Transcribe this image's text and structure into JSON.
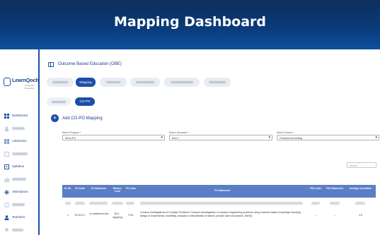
{
  "banner": {
    "title": "Mapping Dashboard"
  },
  "logo": {
    "name": "LearnQoch",
    "tagline": "Outcomes Perfected"
  },
  "sidebar": {
    "items": [
      {
        "label": "Dashboard",
        "icon": "grid-icon",
        "visible": true
      },
      {
        "label": "",
        "icon": "users-icon",
        "visible": false
      },
      {
        "label": "Admission",
        "icon": "doc-icon",
        "visible": true
      },
      {
        "label": "",
        "icon": "book-icon",
        "visible": false
      },
      {
        "label": "Syllabus",
        "icon": "list-icon",
        "visible": true
      },
      {
        "label": "",
        "icon": "chart-icon",
        "visible": false
      },
      {
        "label": "Attendance",
        "icon": "calendar-icon",
        "visible": true
      },
      {
        "label": "",
        "icon": "clock-icon",
        "visible": false
      },
      {
        "label": "Teachers",
        "icon": "teacher-icon",
        "visible": true
      },
      {
        "label": "",
        "icon": "user-icon",
        "visible": false
      }
    ]
  },
  "page": {
    "title": "Outcome Based Education (OBE)"
  },
  "tabs": [
    {
      "label": "",
      "active": false
    },
    {
      "label": "Mapping",
      "active": true
    },
    {
      "label": "",
      "active": false
    },
    {
      "label": "",
      "active": false
    },
    {
      "label": "",
      "active": false
    },
    {
      "label": "",
      "active": false
    }
  ],
  "subtabs": [
    {
      "label": "",
      "active": false
    },
    {
      "label": "CO-PO",
      "active": true
    }
  ],
  "add_mapping": {
    "label": "Add CO-PO Mapping"
  },
  "filters": {
    "program": {
      "label": "Select Program *",
      "value": "MCA (P.I)"
    },
    "semester": {
      "label": "Select Semester *",
      "value": "sem 2"
    },
    "course": {
      "label": "Select Course *",
      "value": "Financial Accounting"
    }
  },
  "search": {
    "placeholder": "Search"
  },
  "table": {
    "headers": [
      "Sr. No.",
      "CO Code",
      "CO Statement",
      "Blooms Level",
      "PO Code",
      "PO Statement",
      "PSO Code",
      "PSO Statement",
      "Average Correlation"
    ],
    "row": {
      "sr": "1",
      "co_code": "EIT212.2",
      "co_statement": "co statement test",
      "blooms": "BL3 - Applying",
      "po_code": "PO1",
      "po_statement": "Conduct Investigations of Complex Problems: Conduct investigations of complex engineering problems using research-based knowledge including design of experiments, modelling, analysis & interpretation of data to provide valid conclusions. (WK8).",
      "pso_code": "–",
      "pso_statement": "–",
      "avg": "2.5"
    }
  },
  "colors": {
    "banner": "#0a3a78",
    "accent": "#1b4fa8",
    "table_header": "#5b7ec6"
  }
}
